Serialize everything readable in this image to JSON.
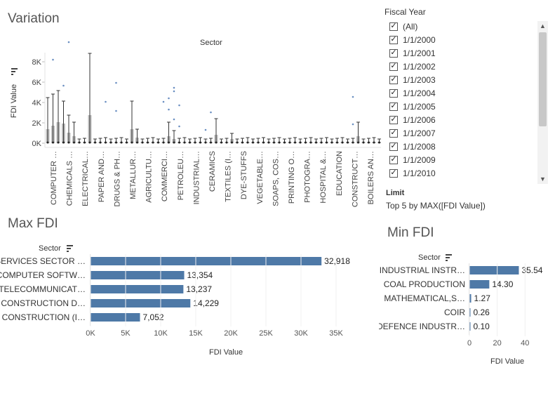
{
  "variation": {
    "title": "Variation",
    "header": "Sector",
    "ylabel": "FDI Value",
    "sort_icon": "sort-icon",
    "yticks": [
      "8K",
      "6K",
      "4K",
      "2K",
      "0K"
    ],
    "sectors": [
      "COMPUTER …",
      "CHEMICALS …",
      "ELECTRICAL…",
      "PAPER AND…",
      "DRUGS & PH…",
      "METALLUR…",
      "AGRICULTU…",
      "COMMERCI…",
      "PETROLEU…",
      "INDUSTRIAL…",
      "CERAMICS",
      "TEXTILES (I…",
      "DYE-STUFFS",
      "VEGETABLE…",
      "SOAPS, COS…",
      "PRINTING O…",
      "PHOTOGRA…",
      "HOSPITAL &…",
      "EDUCATION",
      "CONSTRUCT…",
      "BOILERS AN…"
    ]
  },
  "filter": {
    "title": "Fiscal Year",
    "items": [
      "(All)",
      "1/1/2000",
      "1/1/2001",
      "1/1/2002",
      "1/1/2003",
      "1/1/2004",
      "1/1/2005",
      "1/1/2006",
      "1/1/2007",
      "1/1/2008",
      "1/1/2009",
      "1/1/2010"
    ],
    "check_mark": "✓",
    "scroll_up": "▲",
    "scroll_down": "▼"
  },
  "limit": {
    "title": "Limit",
    "text": "Top 5 by MAX([FDI Value])"
  },
  "max_fdi": {
    "title": "Max FDI",
    "row_header": "Sector",
    "xlabel": "FDI Value",
    "xticks": [
      "0K",
      "5K",
      "10K",
      "15K",
      "20K",
      "25K",
      "30K",
      "35K"
    ],
    "bar_color": "#4e79a7"
  },
  "min_fdi": {
    "title": "Min FDI",
    "row_header": "Sector",
    "xlabel": "FDI Value",
    "xticks": [
      "0",
      "20",
      "40"
    ],
    "bar_color": "#4e79a7"
  },
  "chart_data": [
    {
      "type": "bar",
      "title": "Max FDI",
      "categories": [
        "SERVICES SECTOR …",
        "COMPUTER SOFTW…",
        "TELECOMMUNICAT…",
        "CONSTRUCTION D…",
        "CONSTRUCTION (I…"
      ],
      "values": [
        32918,
        13354,
        13237,
        14229,
        7052
      ],
      "labels": [
        "32,918",
        "13,354",
        "13,237",
        "14,229",
        "7,052"
      ],
      "xlabel": "FDI Value",
      "xlim": [
        0,
        40000
      ]
    },
    {
      "type": "bar",
      "title": "Min FDI",
      "categories": [
        "INDUSTRIAL INSTR…",
        "COAL PRODUCTION",
        "MATHEMATICAL,S…",
        "COIR",
        "DEFENCE INDUSTR…"
      ],
      "values": [
        35.54,
        14.3,
        1.27,
        0.26,
        0.1
      ],
      "labels": [
        "35.54",
        "14.30",
        "1.27",
        "0.26",
        "0.10"
      ],
      "xlabel": "FDI Value",
      "xlim": [
        0,
        58
      ]
    }
  ]
}
